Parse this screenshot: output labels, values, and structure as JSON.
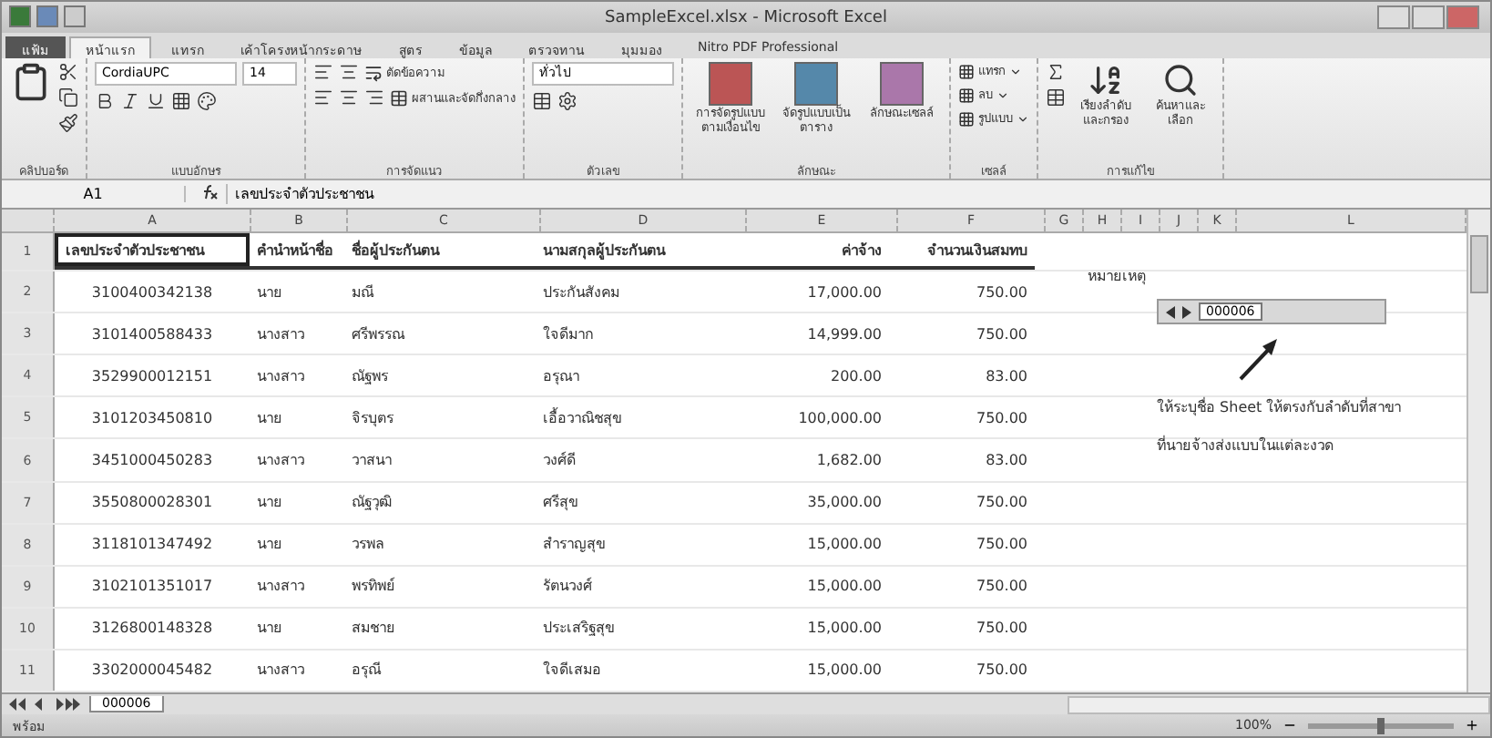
{
  "window": {
    "title": "SampleExcel.xlsx - Microsoft Excel"
  },
  "ribbon_tabs": [
    {
      "label": "แฟ้ม",
      "kind": "file",
      "selected": false
    },
    {
      "label": "หน้าแรก",
      "kind": "tab",
      "selected": true
    },
    {
      "label": "แทรก",
      "kind": "tab",
      "selected": false
    },
    {
      "label": "เค้าโครงหน้ากระดาษ",
      "kind": "tab",
      "selected": false
    },
    {
      "label": "สูตร",
      "kind": "tab",
      "selected": false
    },
    {
      "label": "ข้อมูล",
      "kind": "tab",
      "selected": false
    },
    {
      "label": "ตรวจทาน",
      "kind": "tab",
      "selected": false
    },
    {
      "label": "มุมมอง",
      "kind": "tab",
      "selected": false
    },
    {
      "label": "Nitro PDF Professional",
      "kind": "tab",
      "selected": false
    }
  ],
  "ribbon": {
    "clipboard": {
      "label": "คลิปบอร์ด"
    },
    "font": {
      "label": "แบบอักษร",
      "font_name": "CordiaUPC",
      "font_size": "14"
    },
    "alignment": {
      "label": "การจัดแนว",
      "wrap": "ตัดข้อความ",
      "merge": "ผสานและจัดกึ่งกลาง"
    },
    "number": {
      "label": "ตัวเลข",
      "format": "ทั่วไป"
    },
    "styles": {
      "label": "ลักษณะ",
      "buttons": [
        "การจัดรูปแบบตามเงื่อนไข",
        "จัดรูปแบบเป็นตาราง",
        "ลักษณะเซลล์"
      ]
    },
    "cells": {
      "label": "เซลล์",
      "buttons": [
        "แทรก",
        "ลบ",
        "รูปแบบ"
      ]
    },
    "editing": {
      "label": "การแก้ไข",
      "buttons": [
        "เรียงลำดับและกรอง",
        "ค้นหาและเลือก"
      ]
    }
  },
  "formula_bar": {
    "name_box": "A1",
    "formula": "เลขประจำตัวประชาชน"
  },
  "columns": [
    "A",
    "B",
    "C",
    "D",
    "E",
    "F",
    "G",
    "H",
    "I",
    "J",
    "K",
    "L"
  ],
  "header_row": {
    "number": "1",
    "cells": [
      "เลขประจำตัวประชาชน",
      "คำนำหน้าชื่อ",
      "ชื่อผู้ประกันตน",
      "นามสกุลผู้ประกันตน",
      "ค่าจ้าง",
      "จำนวนเงินสมทบ"
    ]
  },
  "rows": [
    {
      "number": "2",
      "cells": [
        "3100400342138",
        "นาย",
        "มณี",
        "ประกันสังคม",
        "17,000.00",
        "750.00"
      ]
    },
    {
      "number": "3",
      "cells": [
        "3101400588433",
        "นางสาว",
        "ศรีพรรณ",
        "ใจดีมาก",
        "14,999.00",
        "750.00"
      ]
    },
    {
      "number": "4",
      "cells": [
        "3529900012151",
        "นางสาว",
        "ณัฐพร",
        "อรุณา",
        "200.00",
        "83.00"
      ]
    },
    {
      "number": "5",
      "cells": [
        "3101203450810",
        "นาย",
        "จิรบุตร",
        "เอื้อวาณิชสุข",
        "100,000.00",
        "750.00"
      ]
    },
    {
      "number": "6",
      "cells": [
        "3451000450283",
        "นางสาว",
        "วาสนา",
        "วงศ์ดี",
        "1,682.00",
        "83.00"
      ]
    },
    {
      "number": "7",
      "cells": [
        "3550800028301",
        "นาย",
        "ณัฐวุฒิ",
        "ศรีสุข",
        "35,000.00",
        "750.00"
      ]
    },
    {
      "number": "8",
      "cells": [
        "3118101347492",
        "นาย",
        "วรพล",
        "สำราญสุข",
        "15,000.00",
        "750.00"
      ]
    },
    {
      "number": "9",
      "cells": [
        "3102101351017",
        "นางสาว",
        "พรทิพย์",
        "รัตนวงศ์",
        "15,000.00",
        "750.00"
      ]
    },
    {
      "number": "10",
      "cells": [
        "3126800148328",
        "นาย",
        "สมชาย",
        "ประเสริฐสุข",
        "15,000.00",
        "750.00"
      ]
    },
    {
      "number": "11",
      "cells": [
        "3302000045482",
        "นางสาว",
        "อรุณี",
        "ใจดีเสมอ",
        "15,000.00",
        "750.00"
      ]
    }
  ],
  "note": {
    "title": "หมายเหตุ",
    "tab_label": "000006",
    "lines": [
      "ให้ระบุชื่อ Sheet ให้ตรงกับลำดับที่สาขา",
      "ที่นายจ้างส่งแบบในแต่ละงวด"
    ]
  },
  "sheet_tabs": [
    {
      "label": "000006",
      "selected": true
    }
  ],
  "status_bar": {
    "mode": "พร้อม",
    "zoom": "100%",
    "level": 0.5
  }
}
